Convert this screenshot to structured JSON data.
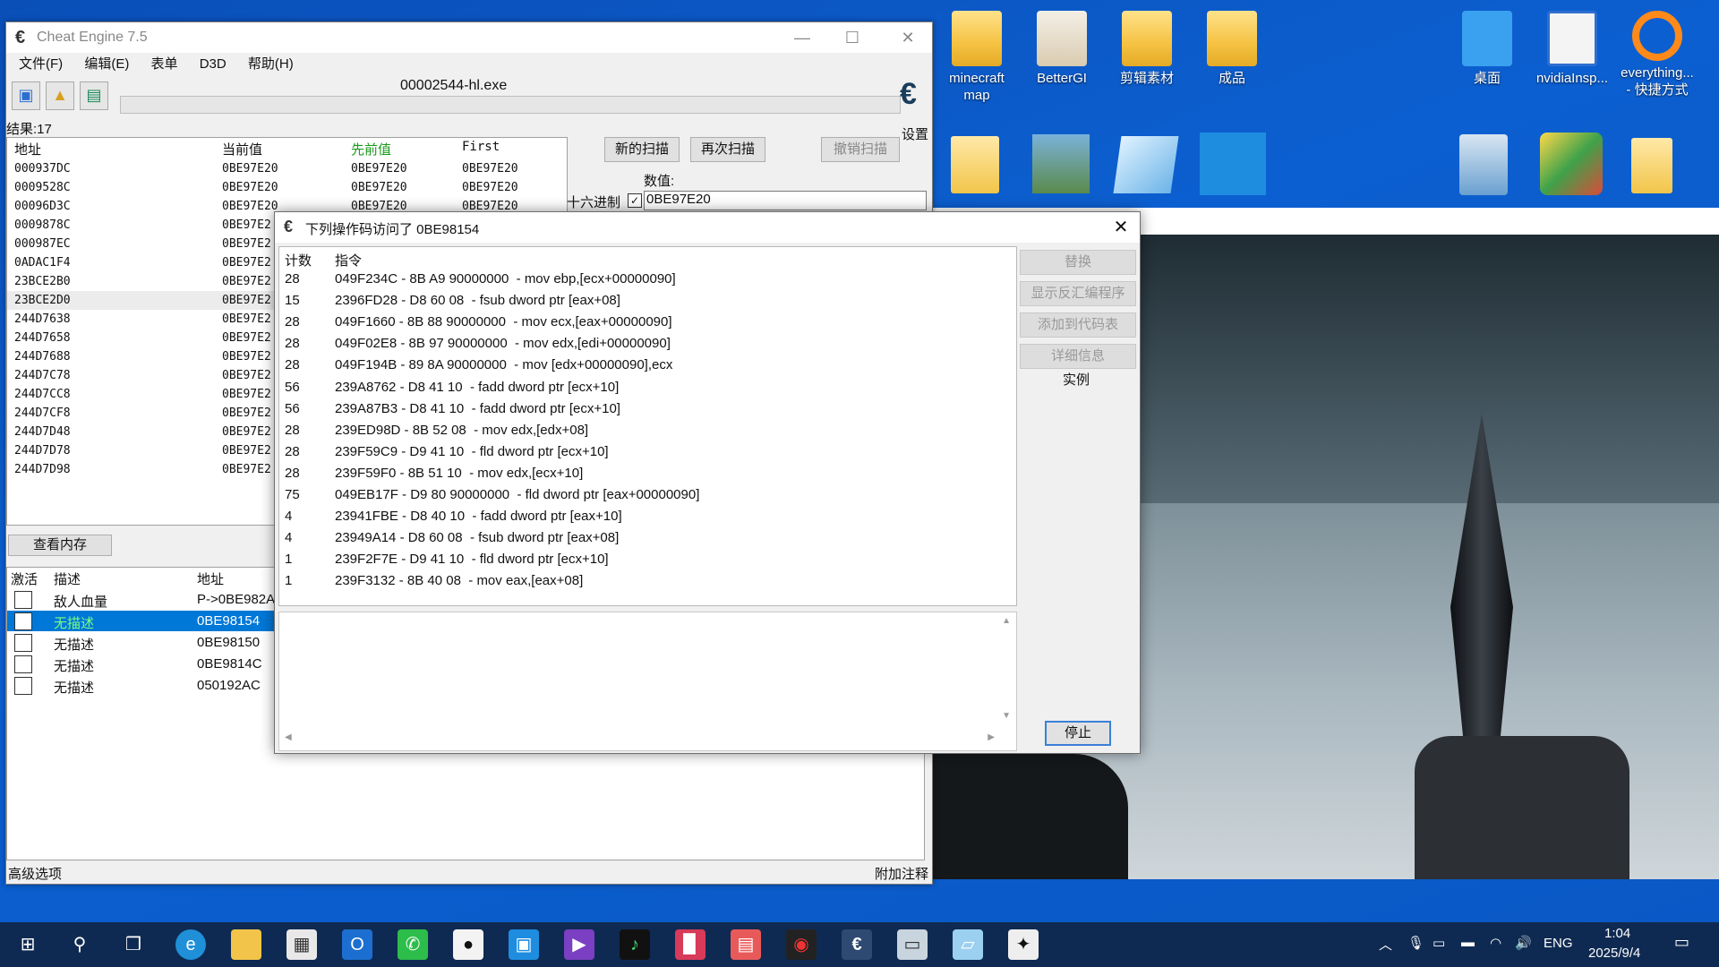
{
  "desktop": {
    "icons": [
      {
        "label": "minecraft\nmap",
        "label1": "minecraft",
        "label2": "map"
      },
      {
        "label1": "BetterGI"
      },
      {
        "label1": "剪辑素材"
      },
      {
        "label1": "成品"
      },
      {
        "label1": "桌面"
      },
      {
        "label1": "nvidiaInsp..."
      },
      {
        "label1": "everything...",
        "label2": "- 快捷方式"
      }
    ]
  },
  "ce": {
    "title": "Cheat Engine 7.5",
    "menu": [
      "文件(F)",
      "编辑(E)",
      "表单",
      "D3D",
      "帮助(H)"
    ],
    "process": "00002544-hl.exe",
    "settings": "设置",
    "results_label": "结果:17",
    "columns": [
      "地址",
      "当前值",
      "先前值",
      "First"
    ],
    "rows": [
      [
        "000937DC",
        "0BE97E20",
        "0BE97E20",
        "0BE97E20"
      ],
      [
        "0009528C",
        "0BE97E20",
        "0BE97E20",
        "0BE97E20"
      ],
      [
        "00096D3C",
        "0BE97E20",
        "0BE97E20",
        "0BE97E20"
      ],
      [
        "0009878C",
        "0BE97E2",
        ""
      ],
      [
        "000987EC",
        "0BE97E2",
        ""
      ],
      [
        "0ADAC1F4",
        "0BE97E2",
        ""
      ],
      [
        "23BCE2B0",
        "0BE97E2",
        ""
      ],
      [
        "23BCE2D0",
        "0BE97E2",
        ""
      ],
      [
        "244D7638",
        "0BE97E2",
        ""
      ],
      [
        "244D7658",
        "0BE97E2",
        ""
      ],
      [
        "244D7688",
        "0BE97E2",
        ""
      ],
      [
        "244D7C78",
        "0BE97E2",
        ""
      ],
      [
        "244D7CC8",
        "0BE97E2",
        ""
      ],
      [
        "244D7CF8",
        "0BE97E2",
        ""
      ],
      [
        "244D7D48",
        "0BE97E2",
        ""
      ],
      [
        "244D7D78",
        "0BE97E2",
        ""
      ],
      [
        "244D7D98",
        "0BE97E2",
        ""
      ]
    ],
    "btn_new_scan": "新的扫描",
    "btn_next_scan": "再次扫描",
    "btn_undo_scan": "撤销扫描",
    "value_label": "数值:",
    "hex_label": "十六进制",
    "value_input": "0BE97E20",
    "view_memory": "查看内存",
    "table_headers": [
      "激活",
      "描述",
      "地址"
    ],
    "table_rows": [
      {
        "desc": "敌人血量",
        "addr": "P->0BE982A"
      },
      {
        "desc": "无描述",
        "addr": "0BE98154"
      },
      {
        "desc": "无描述",
        "addr": "0BE98150"
      },
      {
        "desc": "无描述",
        "addr": "0BE9814C"
      },
      {
        "desc": "无描述",
        "addr": "050192AC"
      }
    ],
    "advanced": "高级选项",
    "add_comment": "附加注释"
  },
  "dialog": {
    "title": "下列操作码访问了 0BE98154",
    "col_count": "计数",
    "col_instr": "指令",
    "rows": [
      {
        "count": "28",
        "instr": "049F234C - 8B A9 90000000  - mov ebp,[ecx+00000090]"
      },
      {
        "count": "15",
        "instr": "2396FD28 - D8 60 08  - fsub dword ptr [eax+08]"
      },
      {
        "count": "28",
        "instr": "049F1660 - 8B 88 90000000  - mov ecx,[eax+00000090]"
      },
      {
        "count": "28",
        "instr": "049F02E8 - 8B 97 90000000  - mov edx,[edi+00000090]"
      },
      {
        "count": "28",
        "instr": "049F194B - 89 8A 90000000  - mov [edx+00000090],ecx"
      },
      {
        "count": "56",
        "instr": "239A8762 - D8 41 10  - fadd dword ptr [ecx+10]"
      },
      {
        "count": "56",
        "instr": "239A87B3 - D8 41 10  - fadd dword ptr [ecx+10]"
      },
      {
        "count": "28",
        "instr": "239ED98D - 8B 52 08  - mov edx,[edx+08]"
      },
      {
        "count": "28",
        "instr": "239F59C9 - D9 41 10  - fld dword ptr [ecx+10]"
      },
      {
        "count": "28",
        "instr": "239F59F0 - 8B 51 10  - mov edx,[ecx+10]"
      },
      {
        "count": "75",
        "instr": "049EB17F - D9 80 90000000  - fld dword ptr [eax+00000090]"
      },
      {
        "count": "4",
        "instr": "23941FBE - D8 40 10  - fadd dword ptr [eax+10]"
      },
      {
        "count": "4",
        "instr": "23949A14 - D8 60 08  - fsub dword ptr [eax+08]"
      },
      {
        "count": "1",
        "instr": "239F2F7E - D9 41 10  - fld dword ptr [ecx+10]"
      },
      {
        "count": "1",
        "instr": "239F3132 - 8B 40 08  - mov eax,[eax+08]"
      }
    ],
    "btn_replace": "替换",
    "btn_disasm": "显示反汇编程序",
    "btn_add_code": "添加到代码表",
    "btn_details": "详细信息",
    "instance": "实例",
    "btn_stop": "停止"
  },
  "taskbar": {
    "lang": "ENG",
    "time": "1:04",
    "date": "2025/9/4"
  }
}
